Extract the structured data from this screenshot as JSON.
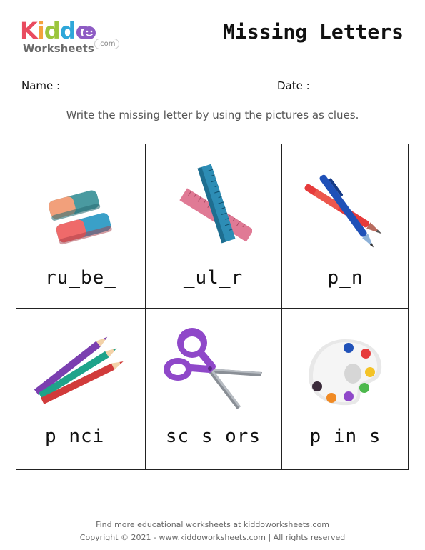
{
  "brand": {
    "logo_letters": [
      "K",
      "i",
      "d",
      "d",
      "o"
    ],
    "logo_colors": [
      "#e94b5f",
      "#f4a23c",
      "#9bc53d",
      "#2fa7d9",
      "#8e5cc4"
    ],
    "logo_sub": "Worksheets",
    "logo_domain": ".com"
  },
  "header": {
    "title": "Missing Letters",
    "name_label": "Name :",
    "date_label": "Date :"
  },
  "instructions": "Write the missing letter by using the pictures as clues.",
  "cards": [
    {
      "word": "ru_be_",
      "icon": "eraser-icon"
    },
    {
      "word": "_ul_r",
      "icon": "ruler-icon"
    },
    {
      "word": "p_n",
      "icon": "pen-icon"
    },
    {
      "word": "p_nci_",
      "icon": "pencil-icon"
    },
    {
      "word": "sc_s_ors",
      "icon": "scissors-icon"
    },
    {
      "word": "p_in_s",
      "icon": "paint-palette-icon"
    }
  ],
  "footer": {
    "line1": "Find more educational worksheets at kiddoworksheets.com",
    "line2": "Copyright © 2021 - www.kiddoworksheets.com  |  All rights reserved"
  }
}
